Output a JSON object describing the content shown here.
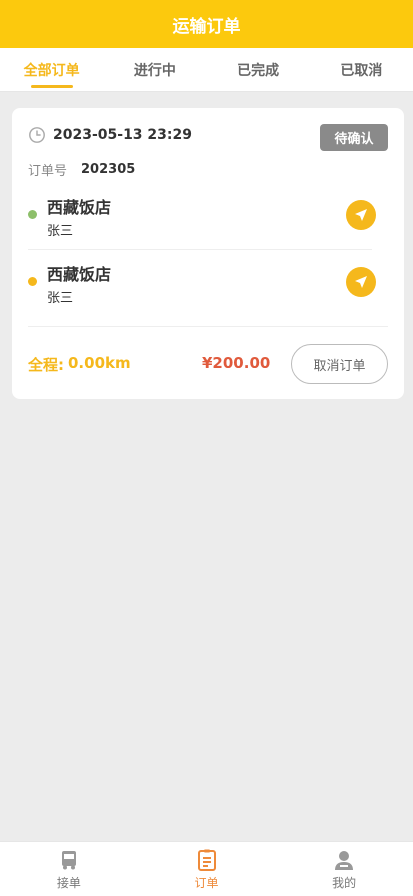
{
  "header": {
    "title": "运输订单"
  },
  "tabs": [
    {
      "label": "全部订单",
      "active": true
    },
    {
      "label": "进行中",
      "active": false
    },
    {
      "label": "已完成",
      "active": false
    },
    {
      "label": "已取消",
      "active": false
    }
  ],
  "order": {
    "time": "2023-05-13 23:29",
    "status": "待确认",
    "order_no_label": "订单号",
    "order_no_value": "202305",
    "stops": [
      {
        "name": "西藏饭店",
        "person": "张三",
        "dot_color": "#8dbf6a"
      },
      {
        "name": "西藏饭店",
        "person": "张三",
        "dot_color": "#f5b81c"
      }
    ],
    "distance_label": "全程:",
    "distance_value": "0.00km",
    "price": "¥200.00",
    "cancel_label": "取消订单"
  },
  "bottom_nav": [
    {
      "label": "接单",
      "icon": "truck-icon",
      "active": false
    },
    {
      "label": "订单",
      "icon": "clipboard-icon",
      "active": true
    },
    {
      "label": "我的",
      "icon": "user-icon",
      "active": false
    }
  ],
  "colors": {
    "brand": "#fcc90d",
    "accent": "#f5b81c",
    "price": "#e05a3c",
    "nav_active": "#ee8a3a"
  }
}
